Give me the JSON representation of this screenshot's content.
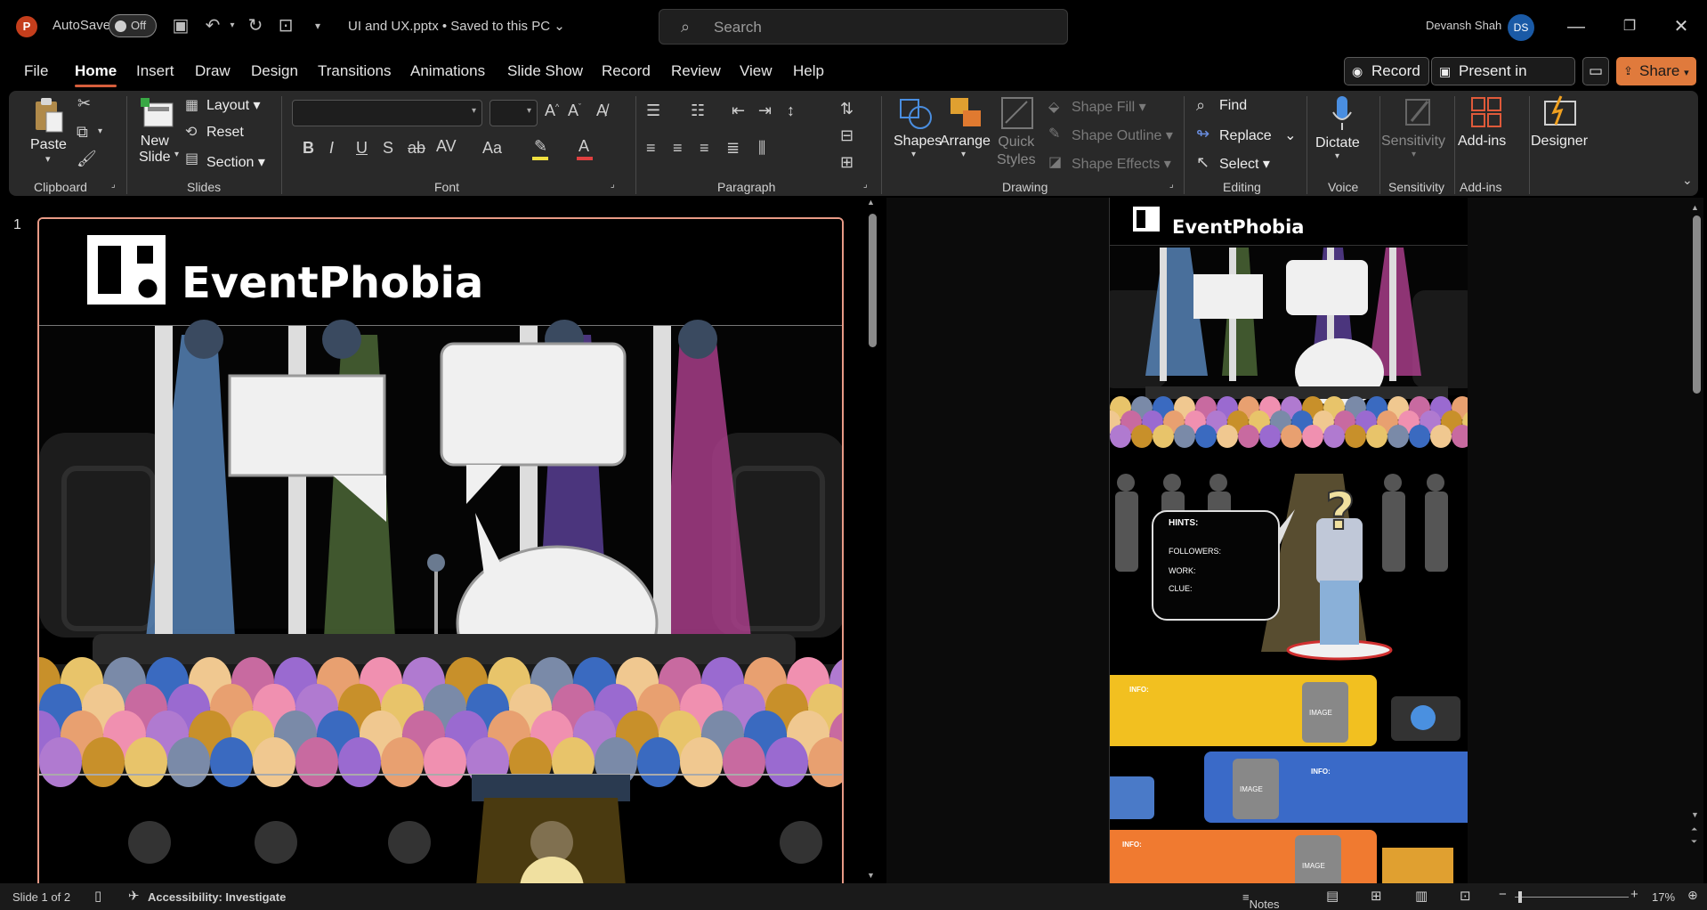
{
  "titlebar": {
    "app_logo": "P",
    "autosave_label": "AutoSave",
    "autosave_state": "Off",
    "filename": "UI and UX.pptx • Saved to this PC",
    "search_placeholder": "Search",
    "username": "Devansh Shah",
    "avatar_initials": "DS"
  },
  "tabs": [
    "File",
    "Home",
    "Insert",
    "Draw",
    "Design",
    "Transitions",
    "Animations",
    "Slide Show",
    "Record",
    "Review",
    "View",
    "Help"
  ],
  "active_tab": "Home",
  "right_buttons": {
    "record": "Record",
    "present": "Present in Teams",
    "share": "Share"
  },
  "ribbon": {
    "groups": [
      "Clipboard",
      "Slides",
      "Font",
      "Paragraph",
      "Drawing",
      "Editing",
      "Voice",
      "Sensitivity",
      "Add-ins"
    ],
    "clipboard": {
      "paste": "Paste"
    },
    "slides": {
      "new_slide": "New\nSlide",
      "layout": "Layout",
      "reset": "Reset",
      "section": "Section"
    },
    "drawing": {
      "shapes": "Shapes",
      "arrange": "Arrange",
      "quick_styles": "Quick\nStyles",
      "shape_fill": "Shape Fill",
      "shape_outline": "Shape Outline",
      "shape_effects": "Shape Effects"
    },
    "editing": {
      "find": "Find",
      "replace": "Replace",
      "select": "Select"
    },
    "voice": {
      "dictate": "Dictate"
    },
    "sensitivity": {
      "sensitivity": "Sensitivity"
    },
    "addins": {
      "addins": "Add-ins"
    },
    "designer": {
      "designer": "Designer"
    }
  },
  "slide_panel": {
    "slide_number": "1",
    "brand": "EventPhobia"
  },
  "editor_slide": {
    "brand": "EventPhobia",
    "hints_title": "HINTS:",
    "hint_followers": "FOLLOWERS:",
    "hint_work": "WORK:",
    "hint_clue": "CLUE:",
    "card_info": "INFO:",
    "card_image": "IMAGE"
  },
  "statusbar": {
    "slide_of": "Slide 1 of 2",
    "accessibility": "Accessibility: Investigate",
    "notes": "Notes",
    "zoom": "17%"
  }
}
